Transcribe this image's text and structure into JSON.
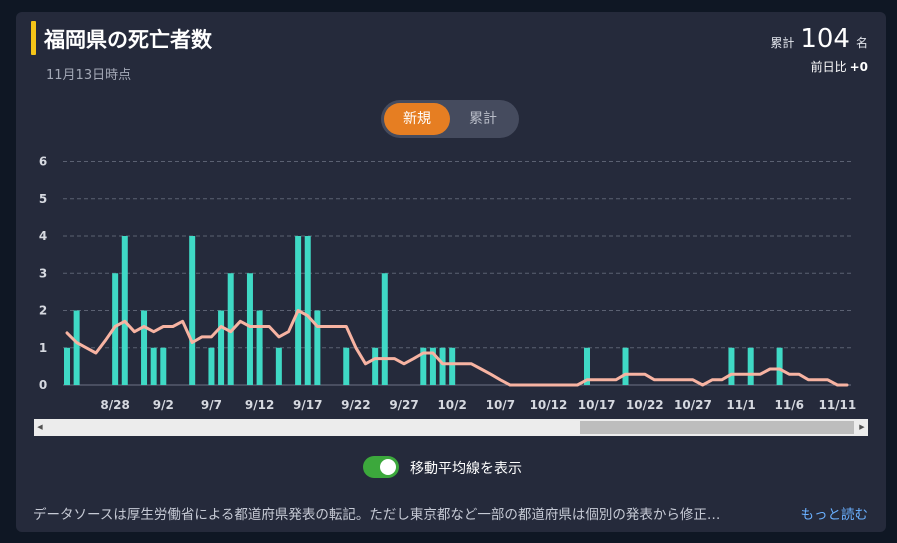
{
  "header": {
    "title": "福岡県の死亡者数",
    "as_of": "11月13日時点",
    "total_label": "累計",
    "total_value": "104",
    "total_unit": "名",
    "diff_label": "前日比",
    "diff_value": "+0"
  },
  "toggle": {
    "new_label": "新規",
    "cumulative_label": "累計",
    "selected": "新規"
  },
  "moving_average": {
    "label": "移動平均線を表示",
    "enabled": true
  },
  "note": {
    "text": "データソースは厚生労働省による都道府県発表の転記。ただし東京都など一部の都道府県は個別の発表から修正…",
    "more_label": "もっと読む"
  },
  "colors": {
    "bar": "#3fd9c5",
    "line": "#f7b3a2",
    "accent": "#e67e22",
    "title_bar": "#f5c518",
    "toggle_on": "#3ca83c",
    "link": "#6ab0ff"
  },
  "chart_data": {
    "type": "bar",
    "x_start": "8/23",
    "x_end": "11/13",
    "xticks": [
      "8/28",
      "9/2",
      "9/7",
      "9/12",
      "9/17",
      "9/22",
      "9/27",
      "10/2",
      "10/7",
      "10/12",
      "10/17",
      "10/22",
      "10/27",
      "11/1",
      "11/6",
      "11/11"
    ],
    "ylim": [
      0,
      6
    ],
    "yticks": [
      0,
      1,
      2,
      3,
      4,
      5,
      6
    ],
    "grid": true,
    "values": [
      1,
      2,
      0,
      0,
      0,
      3,
      4,
      0,
      2,
      1,
      1,
      0,
      0,
      4,
      0,
      1,
      2,
      3,
      0,
      3,
      2,
      0,
      1,
      0,
      4,
      4,
      2,
      0,
      0,
      1,
      0,
      0,
      1,
      3,
      0,
      0,
      0,
      1,
      1,
      1,
      1,
      0,
      0,
      0,
      0,
      0,
      0,
      0,
      0,
      0,
      0,
      0,
      0,
      0,
      1,
      0,
      0,
      0,
      1,
      0,
      0,
      0,
      0,
      0,
      0,
      0,
      0,
      0,
      0,
      1,
      0,
      1,
      0,
      0,
      1,
      0,
      0,
      0,
      0,
      0,
      0,
      0
    ],
    "moving_average": [
      1.4,
      1.14,
      1.0,
      0.86,
      1.2,
      1.57,
      1.71,
      1.43,
      1.57,
      1.43,
      1.57,
      1.57,
      1.71,
      1.14,
      1.29,
      1.29,
      1.57,
      1.43,
      1.71,
      1.57,
      1.57,
      1.57,
      1.29,
      1.43,
      2.0,
      1.86,
      1.57,
      1.57,
      1.57,
      1.57,
      1.0,
      0.57,
      0.71,
      0.71,
      0.71,
      0.57,
      0.71,
      0.86,
      0.86,
      0.57,
      0.57,
      0.57,
      0.57,
      0.43,
      0.29,
      0.14,
      0.0,
      0.0,
      0.0,
      0.0,
      0.0,
      0.0,
      0.0,
      0.0,
      0.14,
      0.14,
      0.14,
      0.14,
      0.29,
      0.29,
      0.29,
      0.14,
      0.14,
      0.14,
      0.14,
      0.14,
      0.0,
      0.14,
      0.14,
      0.29,
      0.29,
      0.29,
      0.29,
      0.43,
      0.43,
      0.29,
      0.29,
      0.14,
      0.14,
      0.14,
      0.0,
      0.0
    ]
  }
}
